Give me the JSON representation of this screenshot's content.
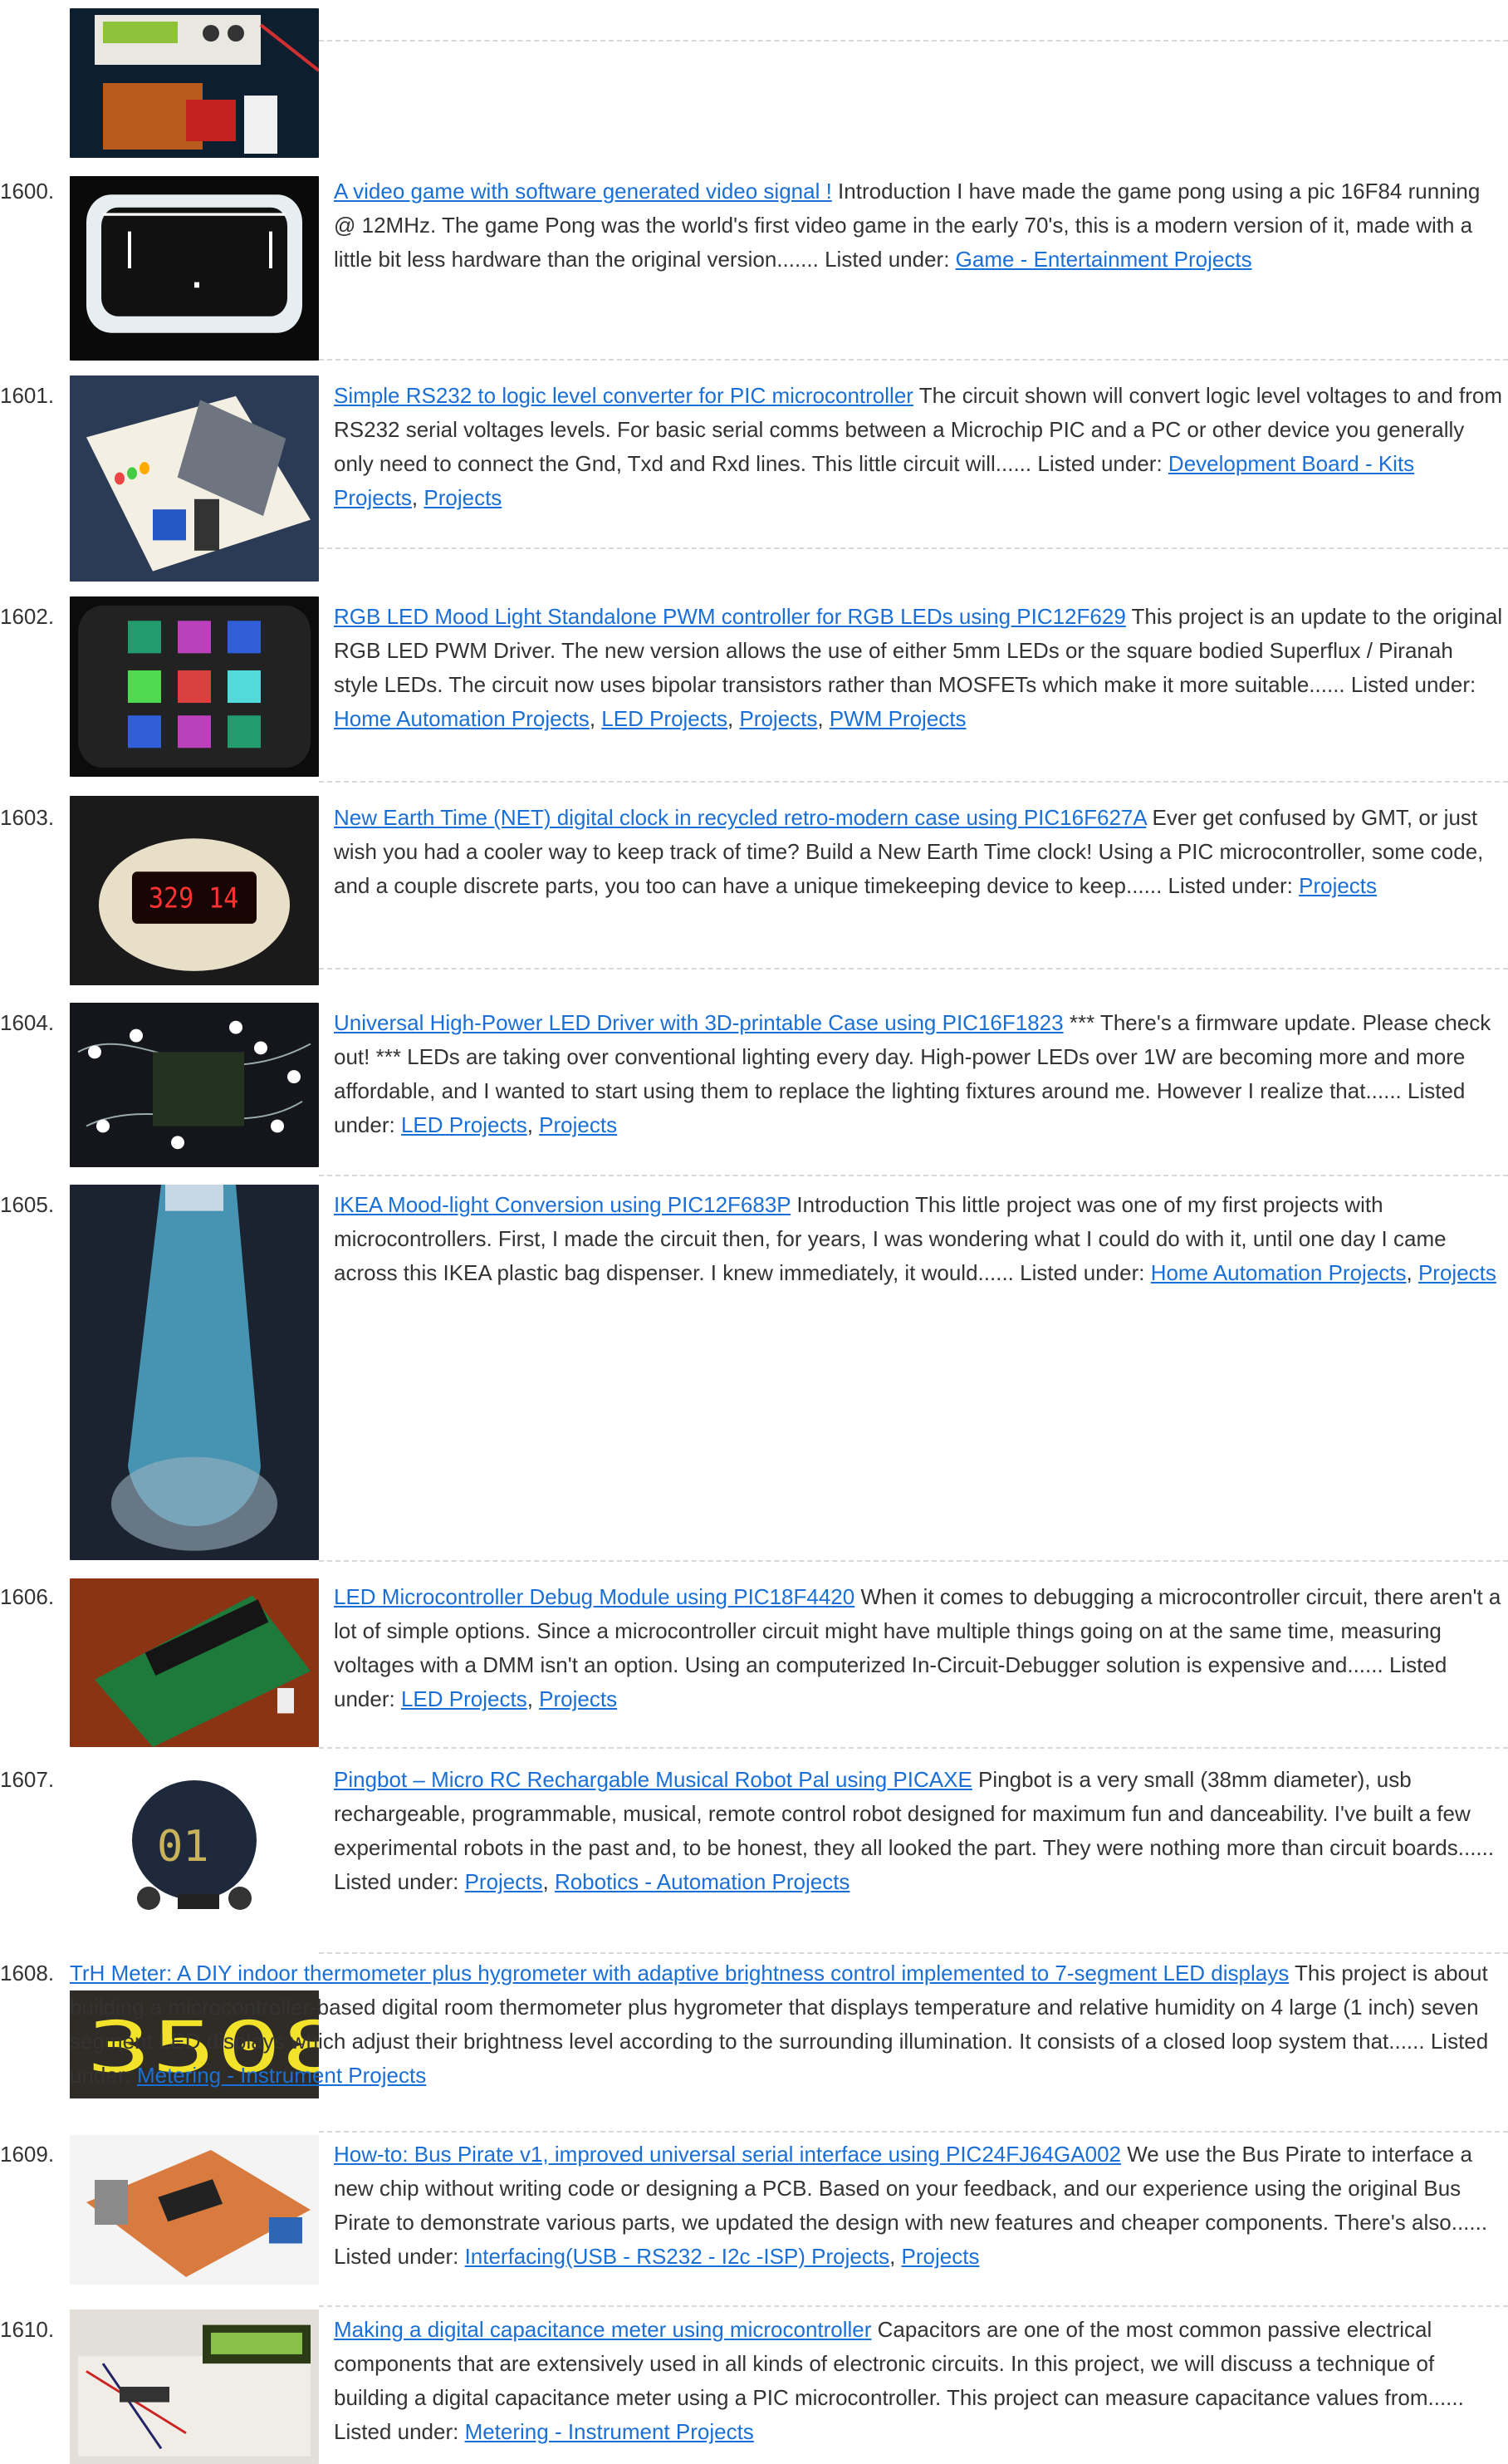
{
  "top_image": {
    "icon": "lcd-circuit-board-photo"
  },
  "entries": [
    {
      "number": "1600.",
      "title": "A video game with software generated video signal !",
      "description": "Introduction I have made the game pong using a pic 16F84 running @ 12MHz. The game Pong was the world's first video game in the early 70's, this is a modern version of it, made with a little bit less hardware than the original version.......",
      "listed_label": "Listed under:",
      "categories": [
        "Game - Entertainment Projects"
      ]
    },
    {
      "number": "1601.",
      "title": "Simple RS232 to logic level converter for PIC microcontroller",
      "description": "The circuit shown will convert logic level voltages to and from RS232 serial voltages levels. For basic serial comms between a Microchip PIC and a PC or other device you generally only need to connect the Gnd, Txd and Rxd lines. This little circuit will......",
      "listed_label": "Listed under:",
      "categories": [
        "Development Board - Kits Projects",
        "Projects"
      ]
    },
    {
      "number": "1602.",
      "title": "RGB LED Mood Light Standalone PWM controller for RGB LEDs using PIC12F629",
      "description": "This project is an update to the original RGB LED PWM Driver.  The new version allows the use of either 5mm LEDs or the square bodied Superflux / Piranah style LEDs.  The circuit now uses bipolar transistors rather than MOSFETs which make it more suitable......",
      "listed_label": "Listed under:",
      "categories": [
        "Home Automation Projects",
        "LED Projects",
        "Projects",
        "PWM Projects"
      ]
    },
    {
      "number": "1603.",
      "title": "New Earth Time (NET) digital clock in recycled retro-modern case using PIC16F627A",
      "description": "Ever get confused by GMT, or just wish you had a cooler way to keep track of time?  Build a New Earth Time clock!  Using a PIC microcontroller, some code, and a couple discrete parts, you too can have a unique timekeeping device to keep......",
      "listed_label": "Listed under:",
      "categories": [
        "Projects"
      ]
    },
    {
      "number": "1604.",
      "title": "Universal High-Power LED Driver with 3D-printable Case using PIC16F1823",
      "description": "*** There's a firmware update. Please check out! *** LEDs are taking over conventional lighting every day. High-power LEDs over 1W are becoming more and more affordable, and I wanted to start using them to replace the lighting fixtures around me. However I realize that......",
      "listed_label": "Listed under:",
      "categories": [
        "LED Projects",
        "Projects"
      ]
    },
    {
      "number": "1605.",
      "title": "IKEA Mood-light Conversion using PIC12F683P",
      "description": "Introduction This little project was one of my first projects with microcontrollers. First, I made the circuit then, for years, I was wondering what I could do with it, until one day I came across this IKEA plastic bag dispenser. I knew immediately, it would......",
      "listed_label": "Listed under:",
      "categories": [
        "Home Automation Projects",
        "Projects"
      ]
    },
    {
      "number": "1606.",
      "title": "LED Microcontroller Debug Module using PIC18F4420",
      "description": "When it comes to debugging a microcontroller circuit, there aren't a lot of simple options.  Since a microcontroller circuit might have multiple things going on at the same time, measuring voltages with a DMM isn't an option.  Using an computerized In-Circuit-Debugger solution is expensive and......",
      "listed_label": "Listed under:",
      "categories": [
        "LED Projects",
        "Projects"
      ]
    },
    {
      "number": "1607.",
      "title": "Pingbot – Micro RC Rechargable Musical Robot Pal using PICAXE",
      "description": "Pingbot is a very small (38mm diameter), usb rechargeable, programmable, musical, remote control robot designed for maximum fun and danceability. I've built a few experimental robots in the past and, to be honest, they all looked the part. They were nothing more than circuit boards......",
      "listed_label": "Listed under:",
      "categories": [
        "Projects",
        "Robotics - Automation Projects"
      ]
    },
    {
      "number": "1608.",
      "title": "TrH Meter: A DIY indoor thermometer plus hygrometer with adaptive brightness control implemented to 7-segment LED displays",
      "description": "This project is about building a microcontroller-based digital room thermometer plus hygrometer that displays temperature and relative humidity on 4 large (1 inch) seven segment LED displays which adjust their brightness level according to the surrounding illumination. It consists of a closed loop system that......",
      "listed_label": "Listed under:",
      "categories": [
        "Metering - Instrument Projects"
      ]
    },
    {
      "number": "1609.",
      "title": "How-to: Bus Pirate v1, improved universal serial interface using PIC24FJ64GA002",
      "description": "We use the Bus Pirate to interface a new chip without writing code or designing a PCB. Based on your feedback, and our experience using the original Bus Pirate to demonstrate various parts, we updated the design with new features and cheaper components. There's also......",
      "listed_label": "Listed under:",
      "categories": [
        "Interfacing(USB - RS232 - I2c -ISP) Projects",
        "Projects"
      ]
    },
    {
      "number": "1610.",
      "title": "Making a digital capacitance meter using microcontroller",
      "description": "Capacitors are one of the most common passive electrical components that are extensively used in all kinds of electronic circuits. In this project, we will discuss a technique of building a digital capacitance meter using a PIC microcontroller. This project can measure capacitance values from......",
      "listed_label": "Listed under:",
      "categories": [
        "Metering - Instrument Projects"
      ]
    }
  ]
}
